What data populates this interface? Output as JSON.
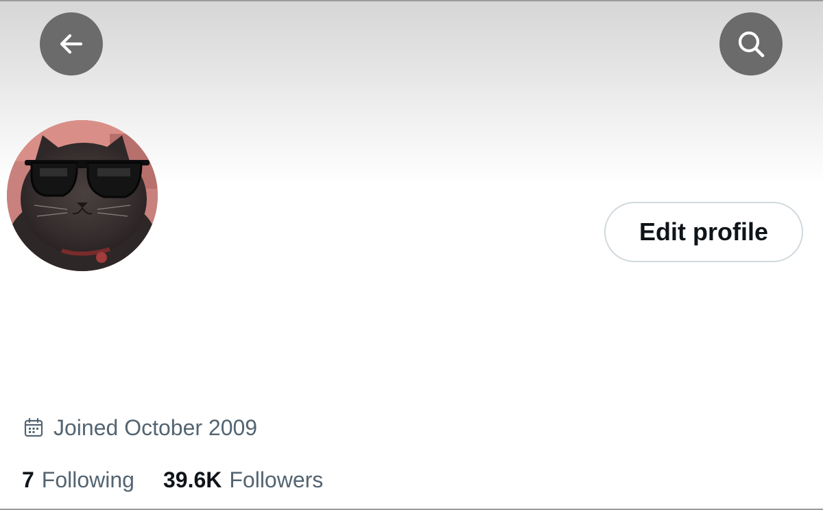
{
  "header": {
    "back_icon": "arrow-left-icon",
    "search_icon": "search-icon"
  },
  "profile": {
    "avatar_description_icon": "cat-with-sunglasses-avatar",
    "edit_button_label": "Edit profile",
    "joined_icon": "calendar-icon",
    "joined_text": "Joined October 2009"
  },
  "stats": {
    "following_count": "7",
    "following_label": "Following",
    "followers_count": "39.6K",
    "followers_label": "Followers"
  },
  "colors": {
    "primary_text": "#0f1419",
    "secondary_text": "#536471",
    "button_border": "#cfd9de",
    "overlay_button": "#6b6b6b"
  }
}
